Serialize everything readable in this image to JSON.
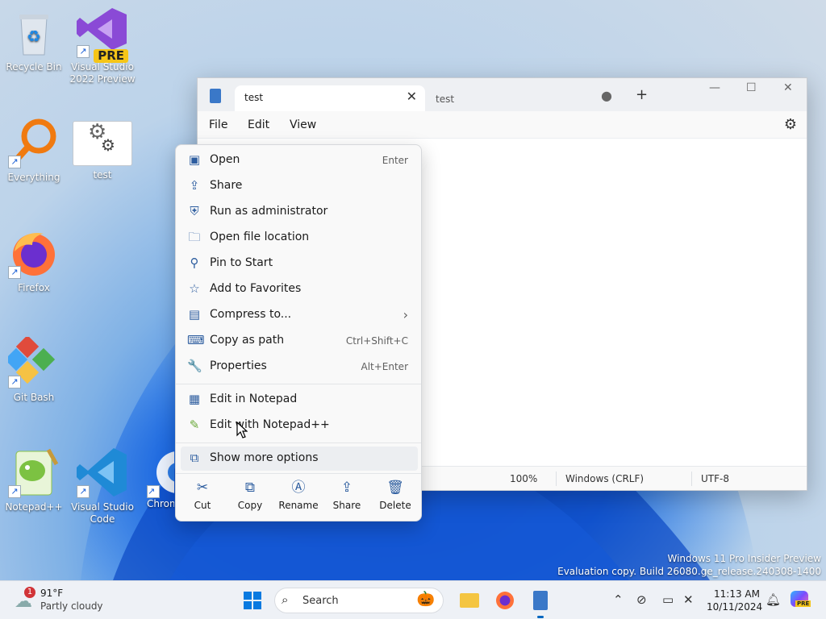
{
  "desktop": {
    "icons": [
      {
        "label": "Recycle Bin"
      },
      {
        "label": "Visual Studio 2022 Preview",
        "badge": "PRE"
      },
      {
        "label": "Everything"
      },
      {
        "label": "test"
      },
      {
        "label": "Firefox"
      },
      {
        "label": "Git Bash"
      },
      {
        "label": "Notepad++"
      },
      {
        "label": "Visual Studio Code"
      },
      {
        "label": "Chrom"
      }
    ]
  },
  "notepad": {
    "tab_active_title": "test",
    "tab_close": "✕",
    "tab2_title": "test",
    "tab2_dot": "●",
    "new_tab": "+",
    "controls": {
      "minimize": "—",
      "maximize": "☐",
      "close": "✕"
    },
    "menu": {
      "file": "File",
      "edit": "Edit",
      "view": "View"
    },
    "status": {
      "zoom": "100%",
      "line_ending": "Windows (CRLF)",
      "encoding": "UTF-8"
    }
  },
  "context_menu": {
    "items": [
      {
        "label": "Open",
        "shortcut": "Enter"
      },
      {
        "label": "Share",
        "shortcut": ""
      },
      {
        "label": "Run as administrator",
        "shortcut": ""
      },
      {
        "label": "Open file location",
        "shortcut": ""
      },
      {
        "label": "Pin to Start",
        "shortcut": ""
      },
      {
        "label": "Add to Favorites",
        "shortcut": ""
      },
      {
        "label": "Compress to...",
        "shortcut": "›"
      },
      {
        "label": "Copy as path",
        "shortcut": "Ctrl+Shift+C"
      },
      {
        "label": "Properties",
        "shortcut": "Alt+Enter"
      },
      {
        "label": "Edit in Notepad",
        "shortcut": ""
      },
      {
        "label": "Edit with Notepad++",
        "shortcut": ""
      },
      {
        "label": "Show more options",
        "shortcut": ""
      }
    ],
    "bottom": [
      {
        "label": "Cut"
      },
      {
        "label": "Copy"
      },
      {
        "label": "Rename"
      },
      {
        "label": "Share"
      },
      {
        "label": "Delete"
      }
    ]
  },
  "watermark": {
    "line1": "Windows 11 Pro Insider Preview",
    "line2": "Evaluation copy. Build 26080.ge_release.240308-1400"
  },
  "taskbar": {
    "weather_badge": "1",
    "temperature": "91°F",
    "condition": "Partly cloudy",
    "search_placeholder": "Search",
    "time": "11:13 AM",
    "date": "10/11/2024",
    "copilot_badge": "PRE"
  },
  "colors": {
    "accent": "#0067c0",
    "taskbar": "#eef1f6",
    "menu_bg": "#f9f9f9"
  }
}
